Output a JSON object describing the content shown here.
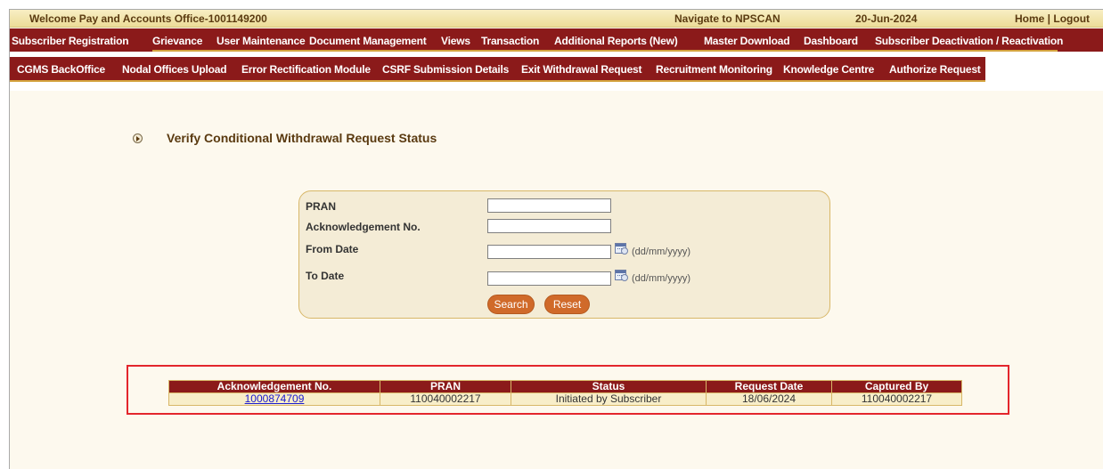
{
  "topbar": {
    "welcome": "Welcome Pay and Accounts Office-1001149200",
    "navigate": "Navigate to NPSCAN",
    "date": "20-Jun-2024",
    "home": "Home",
    "separator": " | ",
    "logout": "Logout"
  },
  "menu_row1": [
    "Subscriber Registration",
    "Grievance",
    "User Maintenance",
    "Document Management",
    "Views",
    "Transaction",
    "Additional Reports (New)",
    "Master Download",
    "Dashboard",
    "Subscriber Deactivation / Reactivation"
  ],
  "menu_row2": [
    "CGMS BackOffice",
    "Nodal Offices Upload",
    "Error Rectification Module",
    "CSRF Submission Details",
    "Exit Withdrawal Request",
    "Recruitment Monitoring",
    "Knowledge Centre",
    "Authorize Request"
  ],
  "page": {
    "title": "Verify Conditional Withdrawal Request Status"
  },
  "form": {
    "pran_label": "PRAN",
    "pran_value": "",
    "ack_label": "Acknowledgement No.",
    "ack_value": "",
    "from_label": "From Date",
    "from_value": "",
    "to_label": "To Date",
    "to_value": "",
    "date_format": "(dd/mm/yyyy)",
    "search_label": "Search",
    "reset_label": "Reset"
  },
  "results": {
    "headers": [
      "Acknowledgement No.",
      "PRAN",
      "Status",
      "Request Date",
      "Captured By"
    ],
    "rows": [
      [
        "1000874709",
        "110040002217",
        "Initiated by Subscriber",
        "18/06/2024",
        "110040002217"
      ]
    ]
  },
  "colors": {
    "menu_bg": "#8b1a1a",
    "accent_gold": "#d4a33e",
    "page_bg": "#fdf9ee",
    "button": "#d06a2a",
    "highlight_border": "#e3262c"
  }
}
